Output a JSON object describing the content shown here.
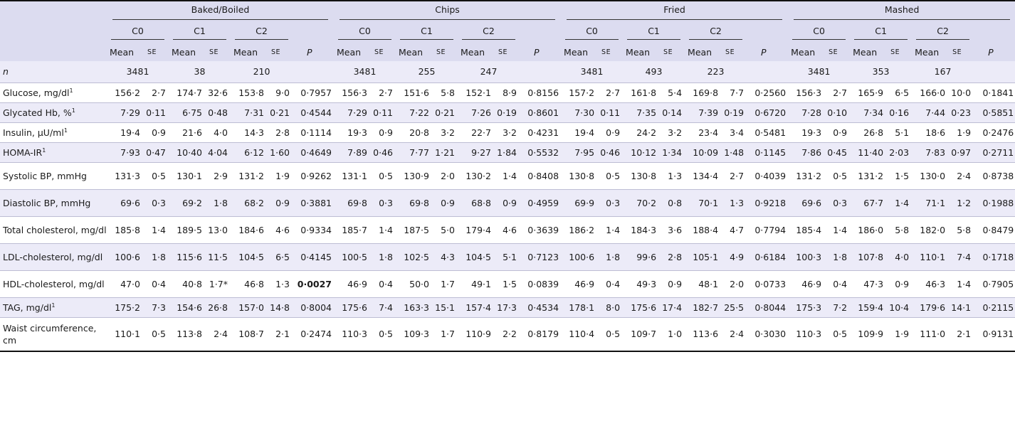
{
  "groups": [
    "Baked/Boiled",
    "Chips",
    "Fried",
    "Mashed"
  ],
  "classes": [
    "C0",
    "C1",
    "C2"
  ],
  "stat_labels": {
    "mean": "Mean",
    "se": "SE",
    "p": "P"
  },
  "rows": [
    {
      "label": "n",
      "italic": true,
      "n": [
        [
          "3481",
          "38",
          "210"
        ],
        [
          "3481",
          "255",
          "247"
        ],
        [
          "3481",
          "493",
          "223"
        ],
        [
          "3481",
          "353",
          "167"
        ]
      ]
    },
    {
      "label": "Glucose, mg/dl",
      "sup": "1",
      "cells": [
        [
          "156·2",
          "2·7",
          "174·7",
          "32·6",
          "153·8",
          "9·0",
          "0·7957"
        ],
        [
          "156·3",
          "2·7",
          "151·6",
          "5·8",
          "152·1",
          "8·9",
          "0·8156"
        ],
        [
          "157·2",
          "2·7",
          "161·8",
          "5·4",
          "169·8",
          "7·7",
          "0·2560"
        ],
        [
          "156·3",
          "2·7",
          "165·9",
          "6·5",
          "166·0",
          "10·0",
          "0·1841"
        ]
      ]
    },
    {
      "label": "Glycated Hb, %",
      "sup": "1",
      "cells": [
        [
          "7·29",
          "0·11",
          "6·75",
          "0·48",
          "7·31",
          "0·21",
          "0·4544"
        ],
        [
          "7·29",
          "0·11",
          "7·22",
          "0·21",
          "7·26",
          "0·19",
          "0·8601"
        ],
        [
          "7·30",
          "0·11",
          "7·35",
          "0·14",
          "7·39",
          "0·19",
          "0·6720"
        ],
        [
          "7·28",
          "0·10",
          "7·34",
          "0·16",
          "7·44",
          "0·23",
          "0·5851"
        ]
      ]
    },
    {
      "label": "Insulin, μU/ml",
      "sup": "1",
      "cells": [
        [
          "19·4",
          "0·9",
          "21·6",
          "4·0",
          "14·3",
          "2·8",
          "0·1114"
        ],
        [
          "19·3",
          "0·9",
          "20·8",
          "3·2",
          "22·7",
          "3·2",
          "0·4231"
        ],
        [
          "19·4",
          "0·9",
          "24·2",
          "3·2",
          "23·4",
          "3·4",
          "0·5481"
        ],
        [
          "19·3",
          "0·9",
          "26·8",
          "5·1",
          "18·6",
          "1·9",
          "0·2476"
        ]
      ]
    },
    {
      "label": "HOMA-IR",
      "sup": "1",
      "cells": [
        [
          "7·93",
          "0·47",
          "10·40",
          "4·04",
          "6·12",
          "1·60",
          "0·4649"
        ],
        [
          "7·89",
          "0·46",
          "7·77",
          "1·21",
          "9·27",
          "1·84",
          "0·5532"
        ],
        [
          "7·95",
          "0·46",
          "10·12",
          "1·34",
          "10·09",
          "1·48",
          "0·1145"
        ],
        [
          "7·86",
          "0·45",
          "11·40",
          "2·03",
          "7·83",
          "0·97",
          "0·2711"
        ]
      ]
    },
    {
      "label": "Systolic BP, mmHg",
      "cells": [
        [
          "131·3",
          "0·5",
          "130·1",
          "2·9",
          "131·2",
          "1·9",
          "0·9262"
        ],
        [
          "131·1",
          "0·5",
          "130·9",
          "2·0",
          "130·2",
          "1·4",
          "0·8408"
        ],
        [
          "130·8",
          "0·5",
          "130·8",
          "1·3",
          "134·4",
          "2·7",
          "0·4039"
        ],
        [
          "131·2",
          "0·5",
          "131·2",
          "1·5",
          "130·0",
          "2·4",
          "0·8738"
        ]
      ]
    },
    {
      "label": "Diastolic BP, mmHg",
      "cells": [
        [
          "69·6",
          "0·3",
          "69·2",
          "1·8",
          "68·2",
          "0·9",
          "0·3881"
        ],
        [
          "69·8",
          "0·3",
          "69·8",
          "0·9",
          "68·8",
          "0·9",
          "0·4959"
        ],
        [
          "69·9",
          "0·3",
          "70·2",
          "0·8",
          "70·1",
          "1·3",
          "0·9218"
        ],
        [
          "69·6",
          "0·3",
          "67·7",
          "1·4",
          "71·1",
          "1·2",
          "0·1988"
        ]
      ]
    },
    {
      "label": "Total cholesterol, mg/dl",
      "cells": [
        [
          "185·8",
          "1·4",
          "189·5",
          "13·0",
          "184·6",
          "4·6",
          "0·9334"
        ],
        [
          "185·7",
          "1·4",
          "187·5",
          "5·0",
          "179·4",
          "4·6",
          "0·3639"
        ],
        [
          "186·2",
          "1·4",
          "184·3",
          "3·6",
          "188·4",
          "4·7",
          "0·7794"
        ],
        [
          "185·4",
          "1·4",
          "186·0",
          "5·8",
          "182·0",
          "5·8",
          "0·8479"
        ]
      ]
    },
    {
      "label": "LDL-cholesterol, mg/dl",
      "cells": [
        [
          "100·6",
          "1·8",
          "115·6",
          "11·5",
          "104·5",
          "6·5",
          "0·4145"
        ],
        [
          "100·5",
          "1·8",
          "102·5",
          "4·3",
          "104·5",
          "5·1",
          "0·7123"
        ],
        [
          "100·6",
          "1·8",
          "99·6",
          "2·8",
          "105·1",
          "4·9",
          "0·6184"
        ],
        [
          "100·3",
          "1·8",
          "107·8",
          "4·0",
          "110·1",
          "7·4",
          "0·1718"
        ]
      ]
    },
    {
      "label": "HDL-cholesterol, mg/dl",
      "cells": [
        [
          "47·0",
          "0·4",
          "40·8",
          "1·7*",
          "46·8",
          "1·3",
          "0·0027"
        ],
        [
          "46·9",
          "0·4",
          "50·0",
          "1·7",
          "49·1",
          "1·5",
          "0·0839"
        ],
        [
          "46·9",
          "0·4",
          "49·3",
          "0·9",
          "48·1",
          "2·0",
          "0·0733"
        ],
        [
          "46·9",
          "0·4",
          "47·3",
          "0·9",
          "46·3",
          "1·4",
          "0·7905"
        ]
      ],
      "bold_p": [
        0
      ]
    },
    {
      "label": "TAG, mg/dl",
      "sup": "1",
      "cells": [
        [
          "175·2",
          "7·3",
          "154·6",
          "26·8",
          "157·0",
          "14·8",
          "0·8004"
        ],
        [
          "175·6",
          "7·4",
          "163·3",
          "15·1",
          "157·4",
          "17·3",
          "0·4534"
        ],
        [
          "178·1",
          "8·0",
          "175·6",
          "17·4",
          "182·7",
          "25·5",
          "0·8044"
        ],
        [
          "175·3",
          "7·2",
          "159·4",
          "10·4",
          "179·6",
          "14·1",
          "0·2115"
        ]
      ]
    },
    {
      "label": "Waist circumference, cm",
      "cells": [
        [
          "110·1",
          "0·5",
          "113·8",
          "2·4",
          "108·7",
          "2·1",
          "0·2474"
        ],
        [
          "110·3",
          "0·5",
          "109·3",
          "1·7",
          "110·9",
          "2·2",
          "0·8179"
        ],
        [
          "110·4",
          "0·5",
          "109·7",
          "1·0",
          "113·6",
          "2·4",
          "0·3030"
        ],
        [
          "110·3",
          "0·5",
          "109·9",
          "1·9",
          "111·0",
          "2·1",
          "0·9131"
        ]
      ]
    }
  ]
}
